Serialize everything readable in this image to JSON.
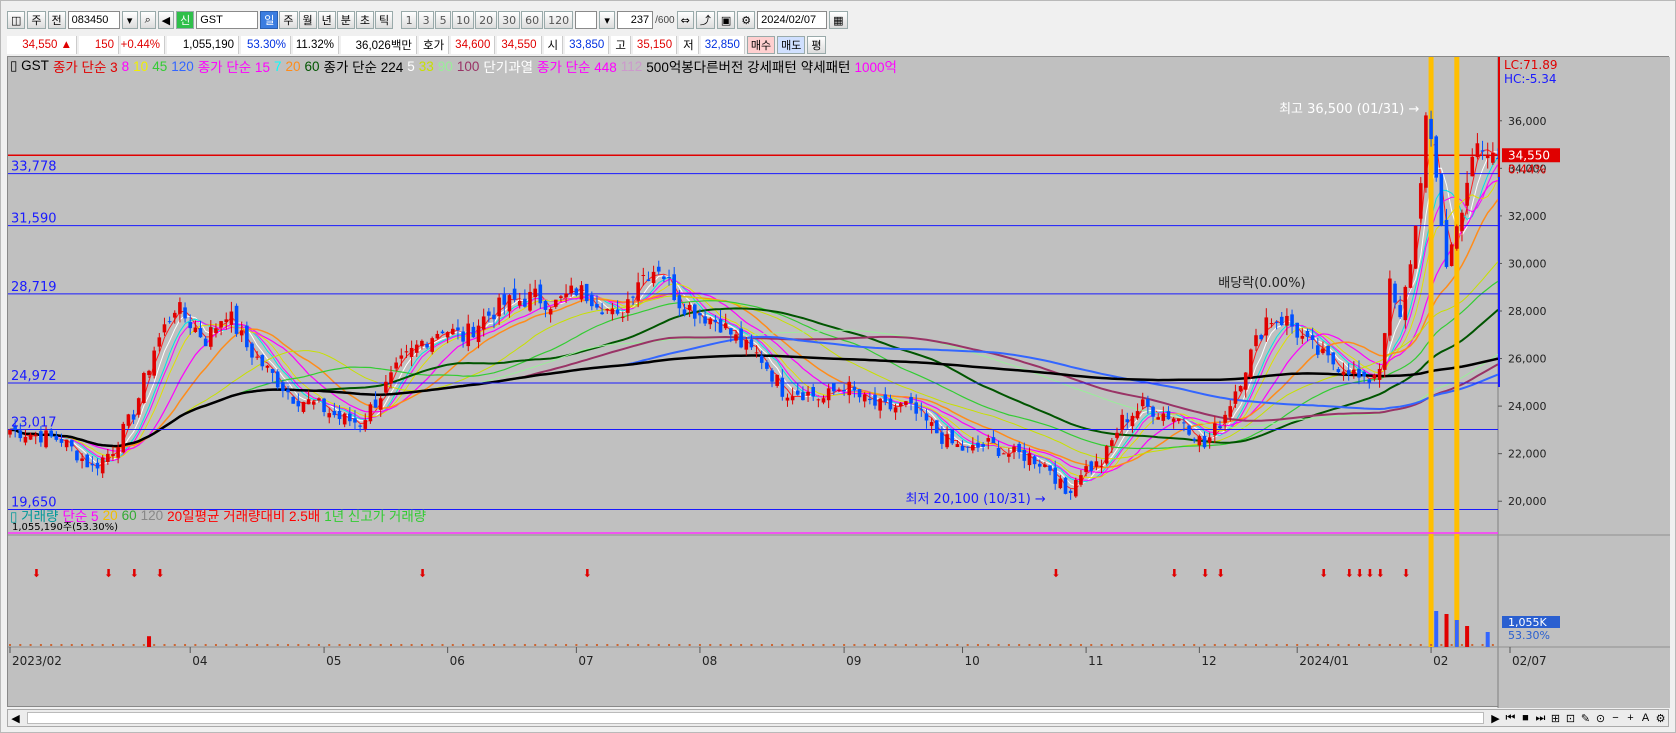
{
  "toolbar": {
    "period_a": "주",
    "period_b": "전",
    "code": "083450",
    "name_flag": "신",
    "name": "GST",
    "tabs": [
      "일",
      "주",
      "월",
      "년",
      "분",
      "초",
      "틱"
    ],
    "active_tab": "일",
    "n_buttons": [
      "1",
      "3",
      "5",
      "10",
      "20",
      "30",
      "60",
      "120"
    ],
    "count": "237",
    "count_total": "/600",
    "date": "2024/02/07"
  },
  "quote": {
    "price": "34,550",
    "arrow": "▲",
    "change": "150",
    "change_pct": "+0.44%",
    "volume": "1,055,190",
    "vol_ratio": "53.30%",
    "turnover": "11.32%",
    "amount": "36,026백만",
    "hoga_label": "호가",
    "hoga1": "34,600",
    "hoga2": "34,550",
    "open_label": "시",
    "open": "33,850",
    "high_label": "고",
    "high": "35,150",
    "low_label": "저",
    "low": "32,850",
    "buy": "매수",
    "sell": "매도",
    "flat": "평"
  },
  "legend1": [
    {
      "t": "GST",
      "c": "#000000"
    },
    {
      "t": "종가 단순 3",
      "c": "#e00000"
    },
    {
      "t": "8",
      "c": "#ff00ff"
    },
    {
      "t": "10",
      "c": "#f0f000"
    },
    {
      "t": "45",
      "c": "#33cc33"
    },
    {
      "t": "120",
      "c": "#3366ff"
    },
    {
      "t": "종가 단순 15",
      "c": "#ff00ff"
    },
    {
      "t": "7",
      "c": "#00ffff"
    },
    {
      "t": "20",
      "c": "#ff8c1a"
    },
    {
      "t": "60",
      "c": "#005500"
    },
    {
      "t": "종가 단순 224",
      "c": "#000000"
    },
    {
      "t": "5",
      "c": "#ffffff"
    },
    {
      "t": "33",
      "c": "#c8e000"
    },
    {
      "t": "90",
      "c": "#99ee99"
    },
    {
      "t": "100",
      "c": "#993366"
    },
    {
      "t": "단기과열",
      "c": "#ffffff"
    },
    {
      "t": "종가 단순 448",
      "c": "#ff00ff"
    },
    {
      "t": "112",
      "c": "#cc99cc"
    },
    {
      "t": "500억봉다른버전 강세패턴",
      "c": "#000000"
    },
    {
      "t": "약세패턴",
      "c": "#000000"
    },
    {
      "t": "1000억",
      "c": "#ff00ff"
    }
  ],
  "legend2": [
    {
      "t": "거래량",
      "c": "#009999"
    },
    {
      "t": "단순 5",
      "c": "#ff00ff"
    },
    {
      "t": "20",
      "c": "#f0c000"
    },
    {
      "t": "60",
      "c": "#33aa33"
    },
    {
      "t": "120",
      "c": "#888888"
    },
    {
      "t": "20일평균 거래량대비 2.5배",
      "c": "#ff0000"
    },
    {
      "t": "1년 신고가 거래량",
      "c": "#33cc33"
    }
  ],
  "vol_note": "1,055,190주(53.30%)",
  "hlines": [
    {
      "v": 33778,
      "label": "33,778"
    },
    {
      "v": 31590,
      "label": "31,590"
    },
    {
      "v": 28719,
      "label": "28,719"
    },
    {
      "v": 24972,
      "label": "24,972"
    },
    {
      "v": 23017,
      "label": "23,017"
    },
    {
      "v": 19650,
      "label": "19,650"
    }
  ],
  "price_line": {
    "v": 34550,
    "label": "34,550",
    "pct": "0.44%"
  },
  "lc": "LC:71.89",
  "hc": "HC:-5.34",
  "annotations": {
    "high": "최고 36,500 (01/31)",
    "low": "최저 20,100 (10/31)",
    "dividend": "배당락(0.00%)"
  },
  "yticks": [
    "36,000",
    "34,000",
    "32,000",
    "30,000",
    "28,000",
    "26,000",
    "24,000",
    "22,000",
    "20,000"
  ],
  "vol_badge": {
    "v": "1,055K",
    "p": "53.30%"
  },
  "chart_data": {
    "type": "candlestick",
    "title": "GST",
    "ylim": [
      19000,
      37000
    ],
    "x_ticks": [
      {
        "i": 0,
        "label": "2023/02"
      },
      {
        "i": 35,
        "label": "04"
      },
      {
        "i": 61,
        "label": "05"
      },
      {
        "i": 85,
        "label": "06"
      },
      {
        "i": 110,
        "label": "07"
      },
      {
        "i": 134,
        "label": "08"
      },
      {
        "i": 162,
        "label": "09"
      },
      {
        "i": 185,
        "label": "10"
      },
      {
        "i": 209,
        "label": "11"
      },
      {
        "i": 231,
        "label": "12"
      },
      {
        "i": 250,
        "label": "2024/01"
      },
      {
        "i": 276,
        "label": "02"
      },
      {
        "i": 289,
        "label": "02/07"
      }
    ],
    "close_path": [
      [
        0,
        23000
      ],
      [
        5,
        22800
      ],
      [
        10,
        22600
      ],
      [
        16,
        21400
      ],
      [
        20,
        22200
      ],
      [
        24,
        23700
      ],
      [
        28,
        26400
      ],
      [
        32,
        28200
      ],
      [
        35,
        27500
      ],
      [
        38,
        26800
      ],
      [
        42,
        28000
      ],
      [
        46,
        26500
      ],
      [
        50,
        25500
      ],
      [
        55,
        24400
      ],
      [
        60,
        24000
      ],
      [
        64,
        23500
      ],
      [
        68,
        23300
      ],
      [
        72,
        24500
      ],
      [
        76,
        25800
      ],
      [
        80,
        26700
      ],
      [
        84,
        27300
      ],
      [
        88,
        26900
      ],
      [
        92,
        27700
      ],
      [
        96,
        28300
      ],
      [
        102,
        28600
      ],
      [
        106,
        28300
      ],
      [
        110,
        28900
      ],
      [
        114,
        28500
      ],
      [
        118,
        27600
      ],
      [
        122,
        29400
      ],
      [
        126,
        29900
      ],
      [
        130,
        28400
      ],
      [
        134,
        27900
      ],
      [
        138,
        27500
      ],
      [
        142,
        26600
      ],
      [
        146,
        26000
      ],
      [
        150,
        24700
      ],
      [
        154,
        24600
      ],
      [
        158,
        24300
      ],
      [
        162,
        24900
      ],
      [
        166,
        24200
      ],
      [
        170,
        23900
      ],
      [
        174,
        24000
      ],
      [
        178,
        23300
      ],
      [
        182,
        22500
      ],
      [
        186,
        22100
      ],
      [
        190,
        22400
      ],
      [
        194,
        22000
      ],
      [
        198,
        21900
      ],
      [
        202,
        21400
      ],
      [
        205,
        20300
      ],
      [
        208,
        21300
      ],
      [
        212,
        21600
      ],
      [
        216,
        23400
      ],
      [
        220,
        24000
      ],
      [
        224,
        23700
      ],
      [
        228,
        23400
      ],
      [
        232,
        22300
      ],
      [
        236,
        23700
      ],
      [
        240,
        25700
      ],
      [
        244,
        27700
      ],
      [
        248,
        27600
      ],
      [
        252,
        26600
      ],
      [
        256,
        25900
      ],
      [
        260,
        25600
      ],
      [
        263,
        24900
      ],
      [
        266,
        25700
      ],
      [
        268,
        29000
      ],
      [
        270,
        27500
      ],
      [
        273,
        31500
      ],
      [
        275,
        36000
      ],
      [
        277,
        33500
      ],
      [
        279,
        30000
      ],
      [
        281,
        31500
      ],
      [
        283,
        33500
      ],
      [
        285,
        34800
      ],
      [
        287,
        34550
      ]
    ],
    "volume_spikes": [
      {
        "i": 27,
        "h": 0.18
      },
      {
        "i": 277,
        "h": 0.6
      },
      {
        "i": 279,
        "h": 0.55
      },
      {
        "i": 281,
        "h": 0.45
      },
      {
        "i": 283,
        "h": 0.35
      },
      {
        "i": 287,
        "h": 0.25
      }
    ]
  }
}
